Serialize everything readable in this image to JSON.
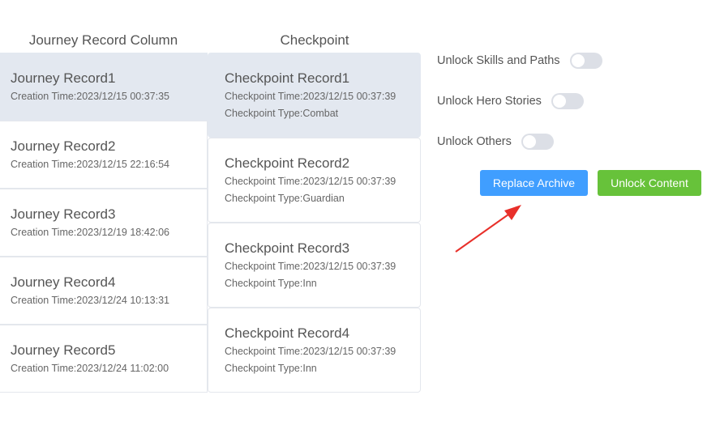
{
  "headers": {
    "journey": "Journey Record Column",
    "checkpoint": "Checkpoint"
  },
  "journey_records": [
    {
      "title": "Journey Record1",
      "creation": "Creation Time:2023/12/15 00:37:35",
      "selected": true
    },
    {
      "title": "Journey Record2",
      "creation": "Creation Time:2023/12/15 22:16:54",
      "selected": false
    },
    {
      "title": "Journey Record3",
      "creation": "Creation Time:2023/12/19 18:42:06",
      "selected": false
    },
    {
      "title": "Journey Record4",
      "creation": "Creation Time:2023/12/24 10:13:31",
      "selected": false
    },
    {
      "title": "Journey Record5",
      "creation": "Creation Time:2023/12/24 11:02:00",
      "selected": false
    }
  ],
  "checkpoints": [
    {
      "title": "Checkpoint Record1",
      "time": "Checkpoint Time:2023/12/15 00:37:39",
      "type": "Checkpoint Type:Combat",
      "selected": true
    },
    {
      "title": "Checkpoint Record2",
      "time": "Checkpoint Time:2023/12/15 00:37:39",
      "type": "Checkpoint Type:Guardian",
      "selected": false
    },
    {
      "title": "Checkpoint Record3",
      "time": "Checkpoint Time:2023/12/15 00:37:39",
      "type": "Checkpoint Type:Inn",
      "selected": false
    },
    {
      "title": "Checkpoint Record4",
      "time": "Checkpoint Time:2023/12/15 00:37:39",
      "type": "Checkpoint Type:Inn",
      "selected": false
    }
  ],
  "toggles": [
    {
      "label": "Unlock Skills and Paths",
      "on": false
    },
    {
      "label": "Unlock Hero Stories",
      "on": false
    },
    {
      "label": "Unlock Others",
      "on": false
    }
  ],
  "buttons": {
    "replace": "Replace Archive",
    "unlock": "Unlock Content"
  },
  "colors": {
    "primary": "#409eff",
    "success": "#67c23a",
    "selected_bg": "#e3e8f0",
    "arrow": "#e8302a"
  }
}
